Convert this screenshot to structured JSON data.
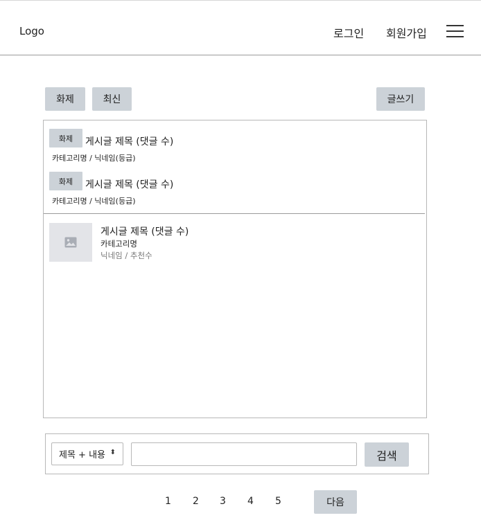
{
  "header": {
    "logo": "Logo",
    "login": "로그인",
    "signup": "회원가입",
    "menu_icon": "hamburger-menu-icon"
  },
  "tabs": [
    {
      "label": "화제"
    },
    {
      "label": "최신"
    }
  ],
  "write_button": "글쓰기",
  "notices": [
    {
      "badge": "화제",
      "title": "게시글 제목 (댓글 수)",
      "meta": "카테고리명 / 닉네임(등급)"
    },
    {
      "badge": "화제",
      "title": "게시글 제목 (댓글 수)",
      "meta": "카테고리명 / 닉네임(등급)"
    }
  ],
  "posts": [
    {
      "thumbnail_icon": "image-placeholder-icon",
      "title": "게시글 제목 (댓글 수)",
      "category": "카테고리명",
      "meta": "닉네임 / 추천수"
    }
  ],
  "search": {
    "select_value": "제목 + 내용",
    "input_value": "",
    "button": "검색"
  },
  "pagination": {
    "pages": [
      "1",
      "2",
      "3",
      "4",
      "5"
    ],
    "next": "다음"
  },
  "colors": {
    "button_bg": "#ccd2d8",
    "thumb_bg": "#e3e4e8",
    "meta_gray": "#777777"
  }
}
